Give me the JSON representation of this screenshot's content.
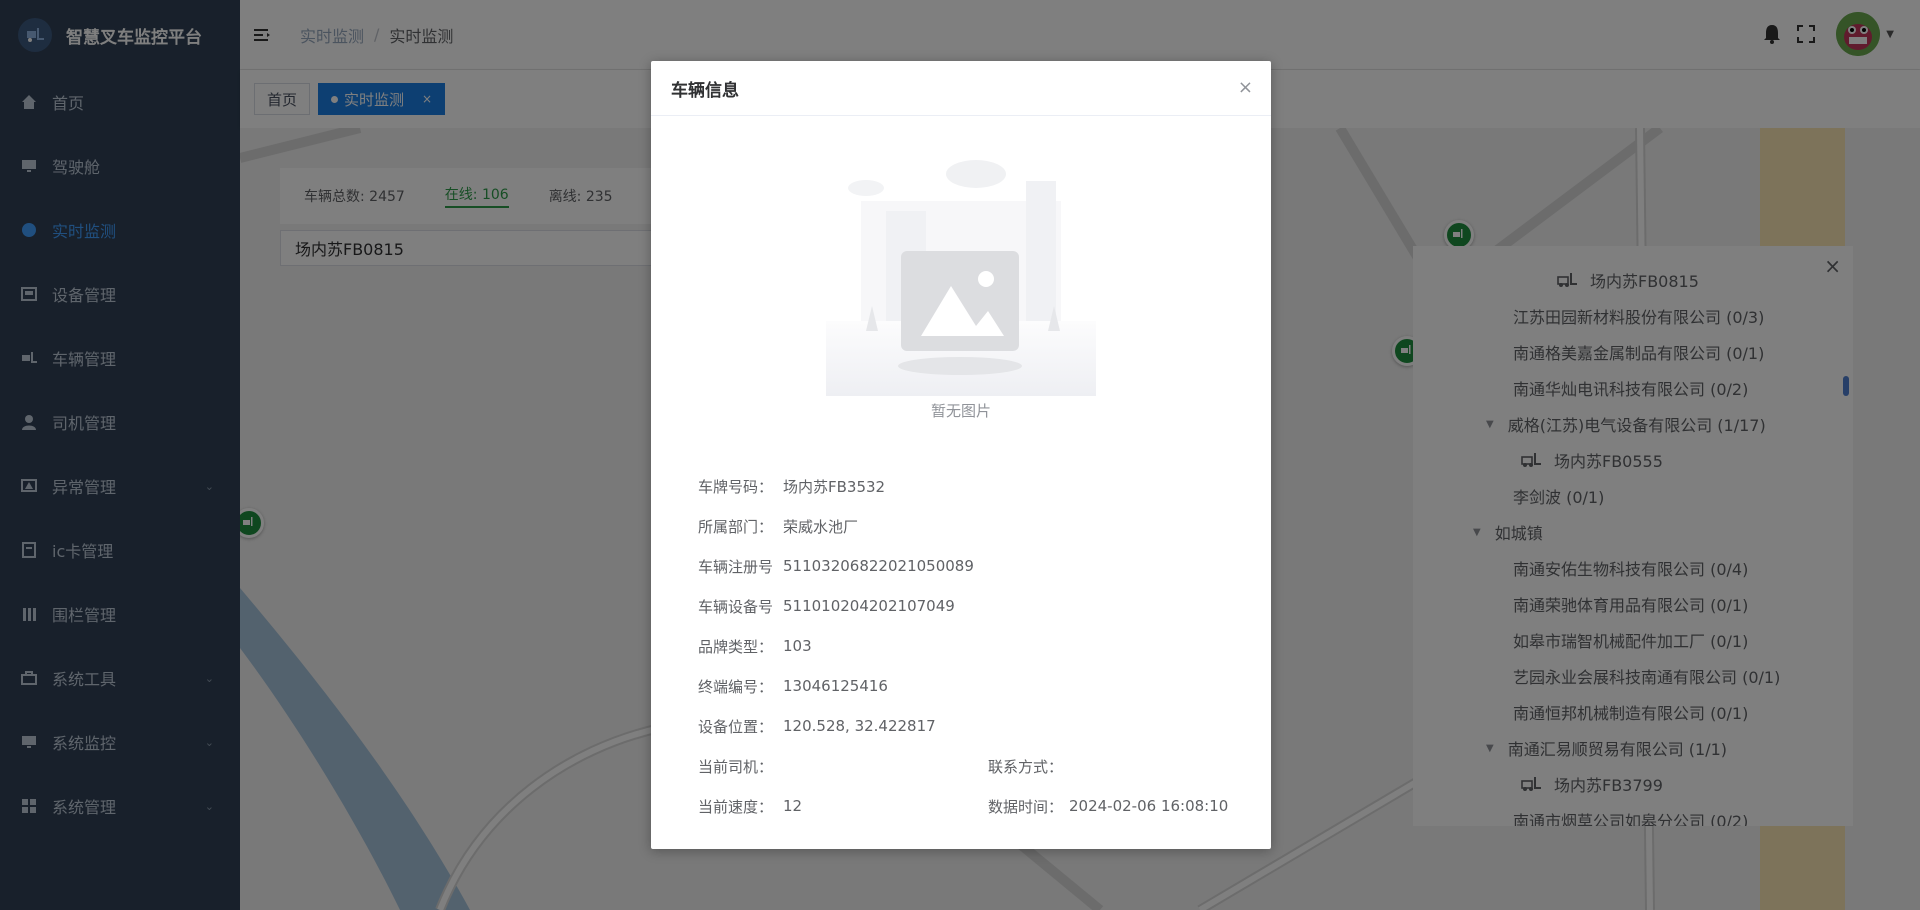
{
  "app": {
    "title": "智慧叉车监控平台"
  },
  "sidebar": {
    "items": [
      {
        "label": "首页",
        "icon": "home-icon"
      },
      {
        "label": "驾驶舱",
        "icon": "monitor-icon"
      },
      {
        "label": "实时监测",
        "icon": "location-icon",
        "active": true
      },
      {
        "label": "设备管理",
        "icon": "device-icon"
      },
      {
        "label": "车辆管理",
        "icon": "forklift-icon"
      },
      {
        "label": "司机管理",
        "icon": "user-icon"
      },
      {
        "label": "异常管理",
        "icon": "alert-icon",
        "expandable": true
      },
      {
        "label": "ic卡管理",
        "icon": "card-icon"
      },
      {
        "label": "围栏管理",
        "icon": "fence-icon"
      },
      {
        "label": "系统工具",
        "icon": "toolbox-icon",
        "expandable": true
      },
      {
        "label": "系统监控",
        "icon": "monitor-icon",
        "expandable": true
      },
      {
        "label": "系统管理",
        "icon": "grid-icon",
        "expandable": true
      }
    ]
  },
  "breadcrumb": {
    "level1": "实时监测",
    "separator": "/",
    "level2": "实时监测"
  },
  "tags": {
    "home": "首页",
    "active": "实时监测",
    "active_close": "×"
  },
  "map": {
    "stats": {
      "total": "车辆总数: 2457",
      "online": "在线: 106",
      "offline": "离线: 235"
    },
    "search_value": "场内苏FB0815"
  },
  "tree": {
    "close": "×",
    "nodes": [
      {
        "text": "场内苏FB0815",
        "type": "vehicle",
        "indent": 1
      },
      {
        "text": "江苏田园新材料股份有限公司  (0/3)",
        "type": "org",
        "indent": 2
      },
      {
        "text": "南通格美嘉金属制品有限公司  (0/1)",
        "type": "org",
        "indent": 2
      },
      {
        "text": "南通华灿电讯科技有限公司  (0/2)",
        "type": "org",
        "indent": 2
      },
      {
        "text": "威格(江苏)电气设备有限公司  (1/17)",
        "type": "org",
        "indent": 2,
        "expanded": true
      },
      {
        "text": "场内苏FB0555",
        "type": "vehicle",
        "indent": 3
      },
      {
        "text": "李剑波  (0/1)",
        "type": "org",
        "indent": 2
      },
      {
        "text": "如城镇",
        "type": "group",
        "indent": 1,
        "expanded": true
      },
      {
        "text": "南通安佑生物科技有限公司  (0/4)",
        "type": "org",
        "indent": 2
      },
      {
        "text": "南通荣驰体育用品有限公司  (0/1)",
        "type": "org",
        "indent": 2
      },
      {
        "text": "如皋市瑞智机械配件加工厂  (0/1)",
        "type": "org",
        "indent": 2
      },
      {
        "text": "艺园永业会展科技南通有限公司  (0/1)",
        "type": "org",
        "indent": 2
      },
      {
        "text": "南通恒邦机械制造有限公司  (0/1)",
        "type": "org",
        "indent": 2
      },
      {
        "text": "南通汇易顺贸易有限公司  (1/1)",
        "type": "org",
        "indent": 2,
        "expanded": true
      },
      {
        "text": "场内苏FB3799",
        "type": "vehicle",
        "indent": 3
      },
      {
        "text": "南通市烟草公司如皋分公司  (0/2)",
        "type": "org",
        "indent": 2
      }
    ]
  },
  "dialog": {
    "title": "车辆信息",
    "close": "×",
    "empty_image_text": "暂无图片",
    "fields": {
      "plate": {
        "label": "车牌号码：",
        "value": "场内苏FB3532"
      },
      "dept": {
        "label": "所属部门：",
        "value": "荣威水池厂"
      },
      "reg_no": {
        "label": "车辆注册号",
        "value": "51103206822021050089"
      },
      "device_no": {
        "label": "车辆设备号",
        "value": "511010204202107049"
      },
      "brand": {
        "label": "品牌类型：",
        "value": "103"
      },
      "terminal": {
        "label": "终端编号：",
        "value": "13046125416"
      },
      "location": {
        "label": "设备位置：",
        "value": "120.528, 32.422817"
      },
      "driver": {
        "label": "当前司机：",
        "value": ""
      },
      "contact": {
        "label": "联系方式：",
        "value": ""
      },
      "speed": {
        "label": "当前速度：",
        "value": "12"
      },
      "data_time": {
        "label": "数据时间：",
        "value": "2024-02-06 16:08:10"
      }
    }
  },
  "colors": {
    "sidebar_bg": "#304156",
    "accent": "#409eff",
    "tag_active": "#1a7fe5",
    "online": "#2e9d4a",
    "marker": "#1e8e3e"
  }
}
